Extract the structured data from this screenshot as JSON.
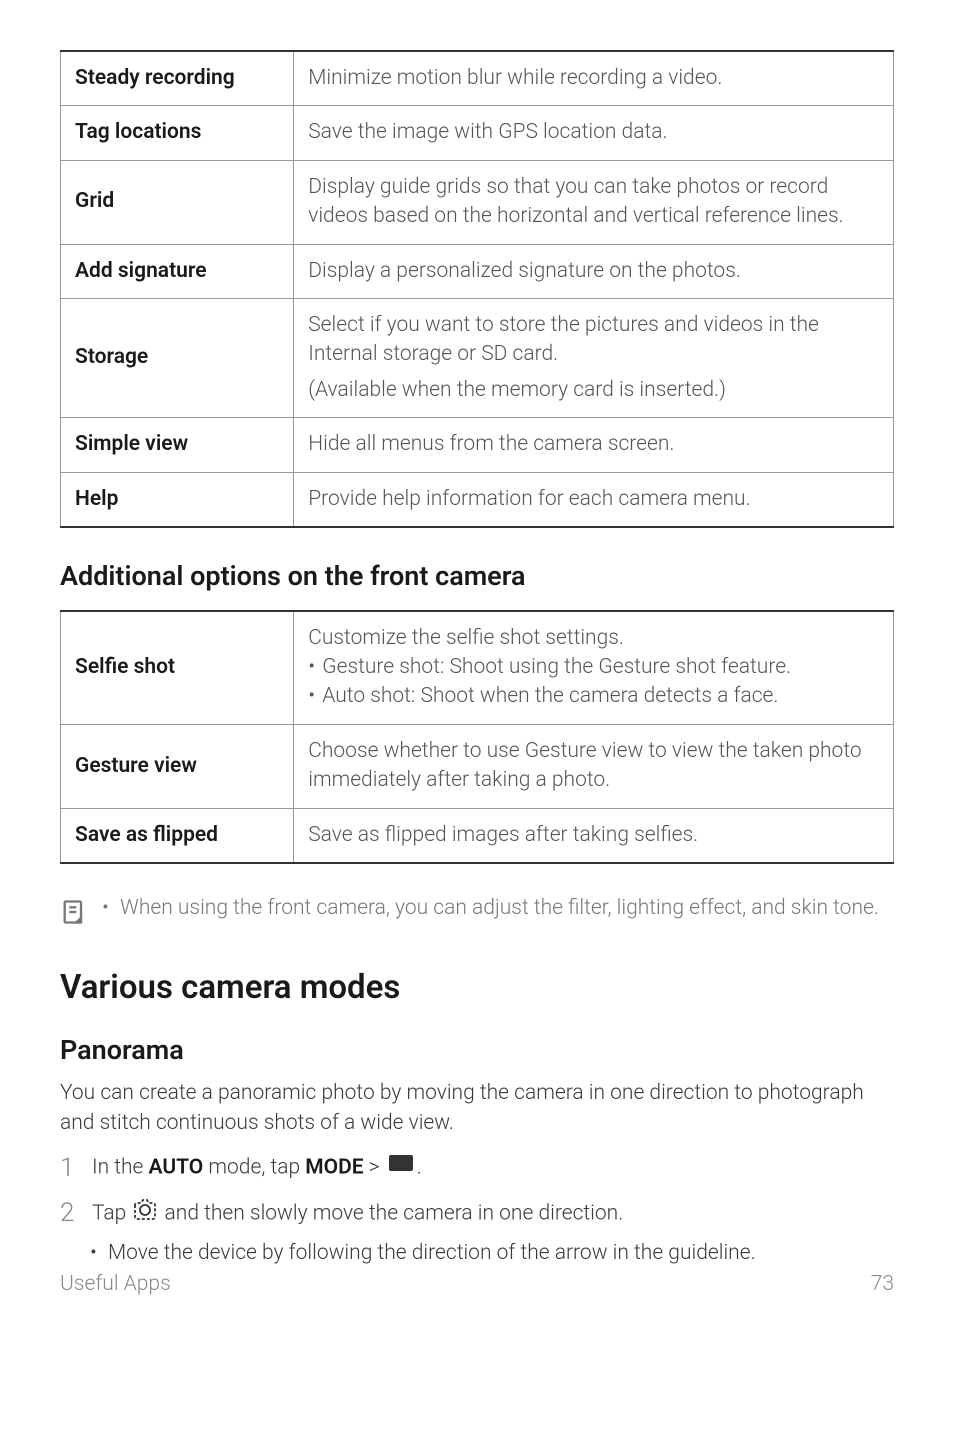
{
  "table1": {
    "rows": [
      {
        "label": "Steady recording",
        "desc": "Minimize motion blur while recording a video."
      },
      {
        "label": "Tag locations",
        "desc": "Save the image with GPS location data."
      },
      {
        "label": "Grid",
        "desc": "Display guide grids so that you can take photos or record videos based on the horizontal and vertical reference lines."
      },
      {
        "label": "Add signature",
        "desc": "Display a personalized signature on the photos."
      },
      {
        "label": "Storage",
        "desc_line1": "Select if you want to store the pictures and videos in the Internal storage or SD card.",
        "desc_line2": "(Available when the memory card is inserted.)"
      },
      {
        "label": "Simple view",
        "desc": "Hide all menus from the camera screen."
      },
      {
        "label": "Help",
        "desc": "Provide help information for each camera menu."
      }
    ]
  },
  "section2_heading": "Additional options on the front camera",
  "table2": {
    "rows": [
      {
        "label": "Selfie shot",
        "desc_intro": "Customize the selfie shot settings.",
        "bullet1": "Gesture shot: Shoot using the Gesture shot feature.",
        "bullet2": "Auto shot: Shoot when the camera detects a face."
      },
      {
        "label": "Gesture view",
        "desc": "Choose whether to use Gesture view to view the taken photo immediately after taking a photo."
      },
      {
        "label": "Save as flipped",
        "desc": "Save as flipped images after taking selfies."
      }
    ]
  },
  "note": {
    "text": "When using the front camera, you can adjust the filter, lighting effect, and skin tone."
  },
  "main_heading": "Various camera modes",
  "panorama": {
    "heading": "Panorama",
    "intro": "You can create a panoramic photo by moving the camera in one direction to photograph and stitch continuous shots of a wide view.",
    "step1_pre": "In the ",
    "step1_auto": "AUTO",
    "step1_mid": " mode, tap ",
    "step1_mode": "MODE",
    "step1_gt": " > ",
    "step1_post": ".",
    "step2_pre": "Tap ",
    "step2_post": " and then slowly move the camera in one direction.",
    "sub_bullet": "Move the device by following the direction of the arrow in the guideline."
  },
  "footer": {
    "left": "Useful Apps",
    "right": "73"
  }
}
